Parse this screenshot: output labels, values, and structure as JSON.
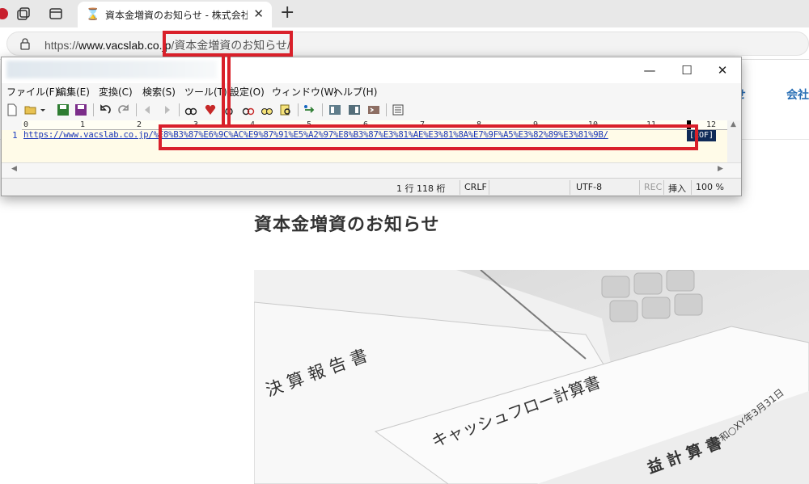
{
  "browser": {
    "tab_title": "資本金増資のお知らせ - 株式会社ヴ",
    "tab_close": "✕",
    "new_tab": "+",
    "url_prefix": "https://",
    "url_host": "www.vacslab.co.jp",
    "url_path": "/資本金増資のお知らせ/"
  },
  "page": {
    "nav_item_1": "せ",
    "nav_item_2": "会社",
    "title": "資本金増資のお知らせ",
    "doc_text_1": "決 算 報 告 書",
    "doc_text_2": "キャッシュフロー計算書",
    "doc_text_3": "益 計 算 書",
    "doc_text_4": "令和○XY年3月31日"
  },
  "editor": {
    "menus": [
      "ファイル(F)",
      "編集(E)",
      "変換(C)",
      "検索(S)",
      "ツール(T)",
      "設定(O)",
      "ウィンドウ(W)",
      "ヘルプ(H)"
    ],
    "ruler_labels": [
      "0",
      "1",
      "2",
      "3",
      "4",
      "5",
      "6",
      "7",
      "8",
      "9",
      "10",
      "11",
      "12"
    ],
    "line_number": "1",
    "text_line": "https://www.vacslab.co.jp/%E8%B3%87%E6%9C%AC%E9%87%91%E5%A2%97%E8%B3%87%E3%81%AE%E3%81%8A%E7%9F%A5%E3%82%89%E3%81%9B/",
    "eof_marker": "[EOF]",
    "status": {
      "position": "1 行  118 桁",
      "line_ending": "CRLF",
      "encoding": "UTF-8",
      "rec": "REC",
      "insert_mode": "挿入",
      "zoom": "100 %"
    },
    "window_buttons": {
      "minimize": "—",
      "maximize": "☐",
      "close": "✕"
    }
  },
  "colors": {
    "highlight": "#d9202a",
    "link_text": "#1a36b8",
    "eof_bg": "#0f2a58",
    "site_accent": "#2a6fb5"
  }
}
